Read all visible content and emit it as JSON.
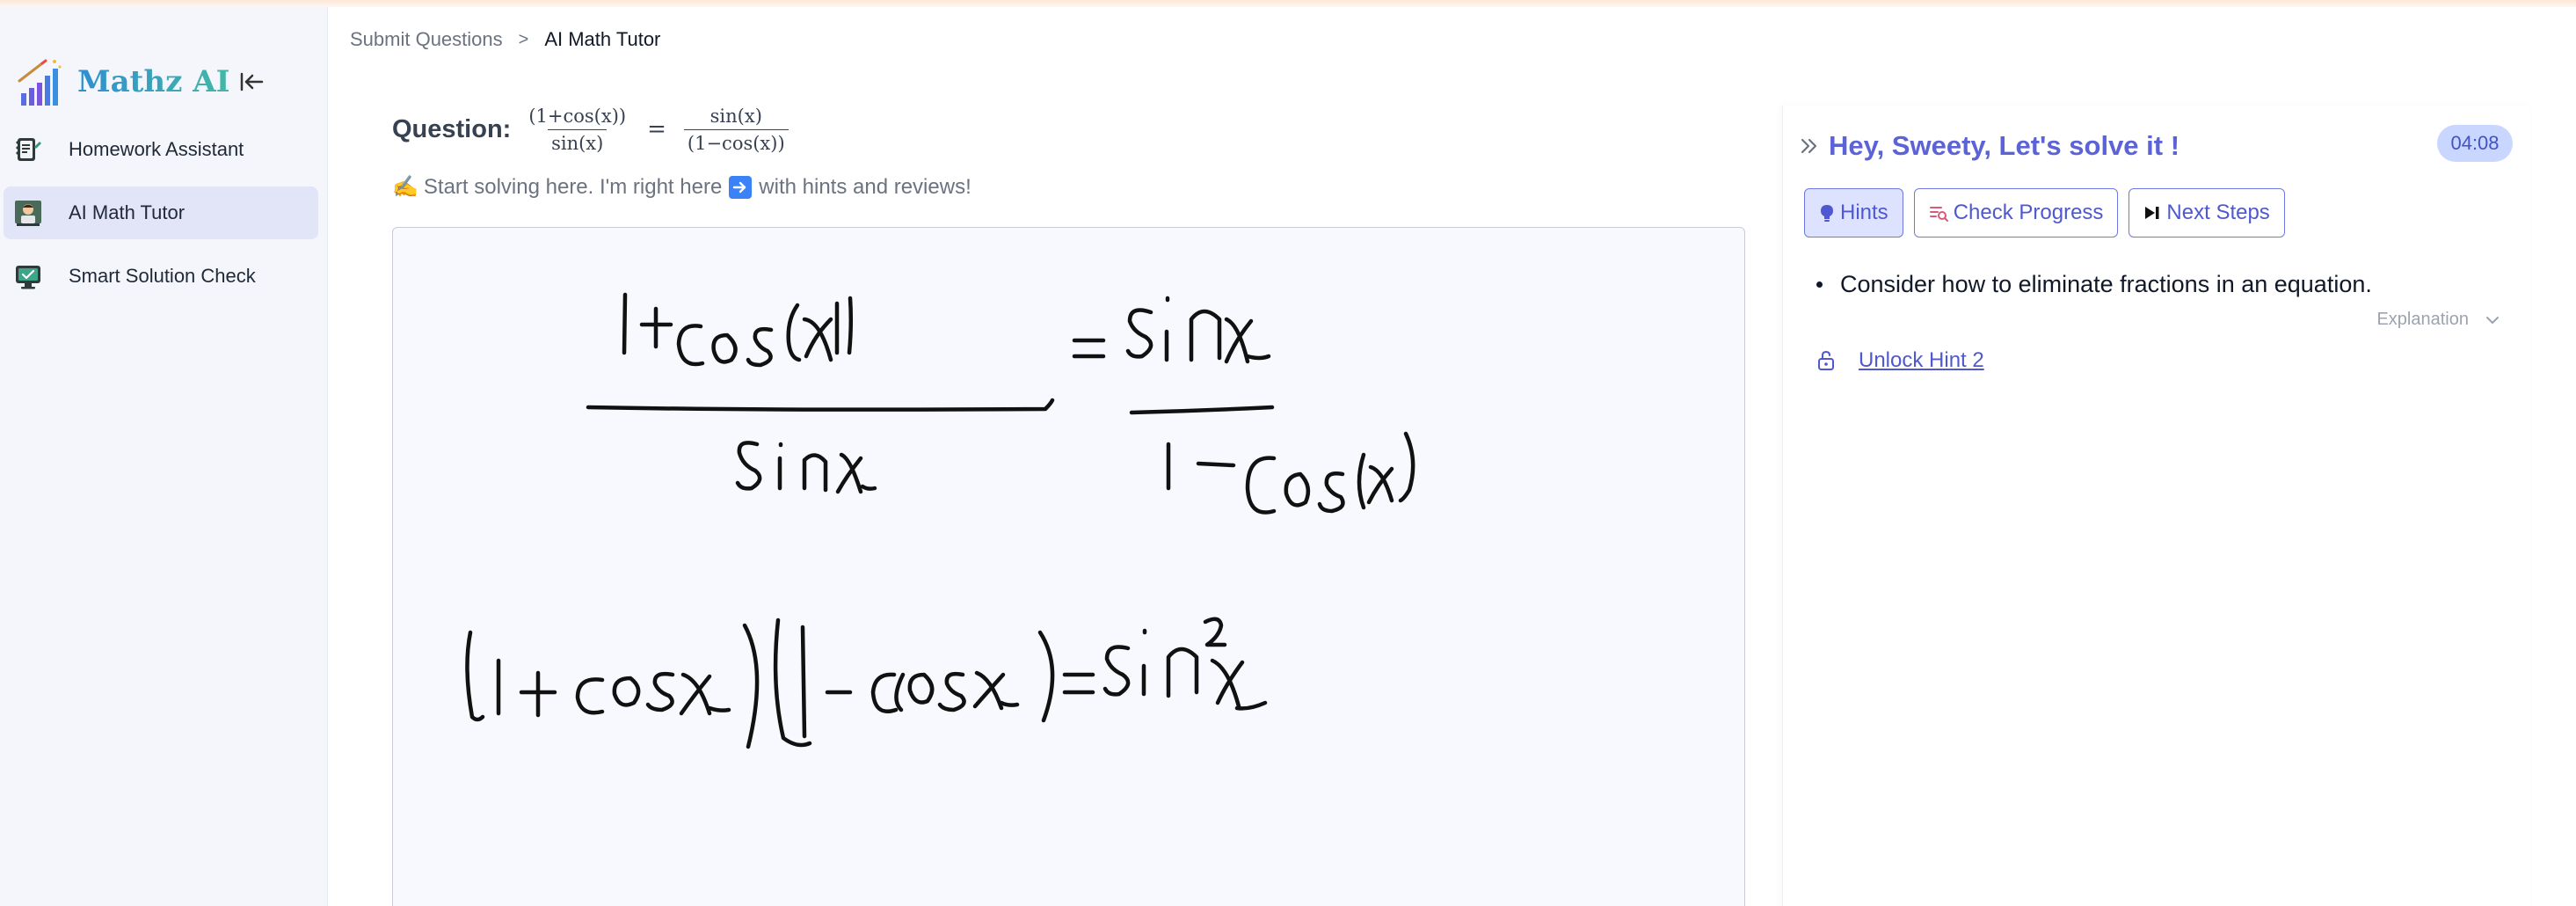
{
  "app": {
    "name": "Mathz AI"
  },
  "sidebar": {
    "items": [
      {
        "label": "Homework Assistant",
        "icon": "notebook-pen-icon",
        "active": false
      },
      {
        "label": "AI Math Tutor",
        "icon": "tutor-avatar-icon",
        "active": true
      },
      {
        "label": "Smart Solution Check",
        "icon": "monitor-check-icon",
        "active": false
      }
    ]
  },
  "breadcrumb": {
    "parent": "Submit Questions",
    "separator": ">",
    "current": "AI Math Tutor"
  },
  "question": {
    "label": "Question:",
    "lhs_num": "(1+cos(x))",
    "lhs_den": "sin(x)",
    "equals": "=",
    "rhs_num": "sin(x)",
    "rhs_den": "(1−cos(x))"
  },
  "prompt": {
    "emoji": "✍️",
    "before": "Start solving here. I'm right here",
    "after": "with hints and reviews!"
  },
  "tutor": {
    "title": "Hey, Sweety, Let's solve it !",
    "timer": "04:08",
    "tabs": [
      {
        "label": "Hints",
        "icon": "lightbulb-icon",
        "active": true
      },
      {
        "label": "Check Progress",
        "icon": "progress-icon",
        "active": false
      },
      {
        "label": "Next Steps",
        "icon": "skip-forward-icon",
        "active": false
      }
    ],
    "hint": "Consider how to eliminate fractions in an equation.",
    "explanation_label": "Explanation",
    "unlock_label": "Unlock Hint 2"
  },
  "colors": {
    "accent": "#5b63d6",
    "active_nav": "#e2e4f8",
    "timer_bg": "#c9d6ff"
  }
}
